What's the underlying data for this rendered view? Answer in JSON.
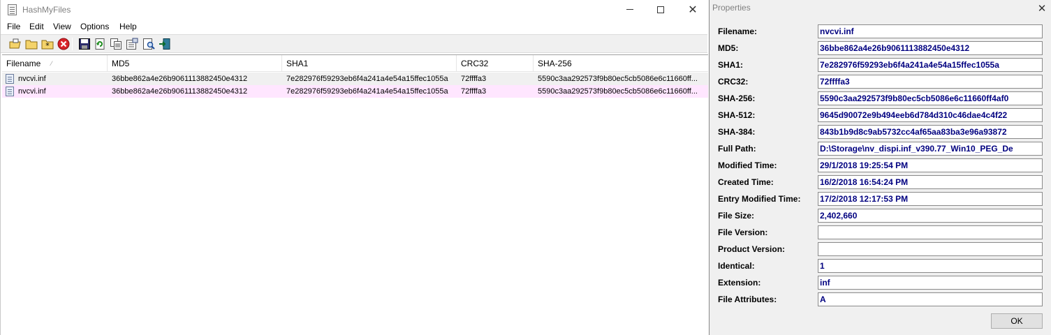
{
  "main": {
    "title": "HashMyFiles",
    "menu": [
      "File",
      "Edit",
      "View",
      "Options",
      "Help"
    ],
    "toolbar_icons": [
      "open-file-icon",
      "open-folder-icon",
      "add-wildcard-icon",
      "delete-icon",
      "save-icon",
      "refresh-icon",
      "copy-icon",
      "properties-icon",
      "find-icon",
      "exit-icon"
    ],
    "columns": [
      "Filename",
      "MD5",
      "SHA1",
      "CRC32",
      "SHA-256"
    ],
    "rows": [
      [
        "nvcvi.inf",
        "36bbe862a4e26b9061113882450e4312",
        "7e282976f59293eb6f4a241a4e54a15ffec1055a",
        "72ffffa3",
        "5590c3aa292573f9b80ec5cb5086e6c11660ff..."
      ],
      [
        "nvcvi.inf",
        "36bbe862a4e26b9061113882450e4312",
        "7e282976f59293eb6f4a241a4e54a15ffec1055a",
        "72ffffa3",
        "5590c3aa292573f9b80ec5cb5086e6c11660ff..."
      ]
    ],
    "row_colors": [
      "#f0f0f0",
      "#ffe6ff"
    ]
  },
  "props": {
    "title": "Properties",
    "fields": [
      {
        "label": "Filename:",
        "value": "nvcvi.inf"
      },
      {
        "label": "MD5:",
        "value": "36bbe862a4e26b9061113882450e4312"
      },
      {
        "label": "SHA1:",
        "value": "7e282976f59293eb6f4a241a4e54a15ffec1055a"
      },
      {
        "label": "CRC32:",
        "value": "72ffffa3"
      },
      {
        "label": "SHA-256:",
        "value": "5590c3aa292573f9b80ec5cb5086e6c11660ff4af0"
      },
      {
        "label": "SHA-512:",
        "value": "9645d90072e9b494eeb6d784d310c46dae4c4f22"
      },
      {
        "label": "SHA-384:",
        "value": "843b1b9d8c9ab5732cc4af65aa83ba3e96a93872"
      },
      {
        "label": "Full Path:",
        "value": "D:\\Storage\\nv_dispi.inf_v390.77_Win10_PEG_De"
      },
      {
        "label": "Modified Time:",
        "value": "29/1/2018 19:25:54 PM"
      },
      {
        "label": "Created Time:",
        "value": "16/2/2018 16:54:24 PM"
      },
      {
        "label": "Entry Modified Time:",
        "value": "17/2/2018 12:17:53 PM"
      },
      {
        "label": "File Size:",
        "value": "2,402,660"
      },
      {
        "label": "File Version:",
        "value": ""
      },
      {
        "label": "Product Version:",
        "value": ""
      },
      {
        "label": "Identical:",
        "value": "1"
      },
      {
        "label": "Extension:",
        "value": "inf"
      },
      {
        "label": "File Attributes:",
        "value": "A"
      }
    ],
    "ok_label": "OK"
  }
}
